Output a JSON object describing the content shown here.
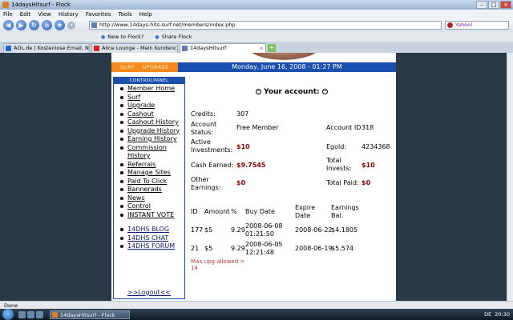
{
  "window": {
    "title": "14daysHitsurf - Flock"
  },
  "menu": [
    "File",
    "Edit",
    "View",
    "History",
    "Favorites",
    "Tools",
    "Help"
  ],
  "nav": {
    "url": "http://www.14days-hits-surf.net/members/index.php",
    "search_placeholder": "Yahoo!"
  },
  "bookmarks": [
    "New to Flock?",
    "Share Flock"
  ],
  "tabs": [
    {
      "label": "AOL.de | Kostenlose Email, Nachri...",
      "active": false
    },
    {
      "label": "Alice Lounge - Mein Kundencenter",
      "active": false
    },
    {
      "label": "14daysHitsurf",
      "active": true
    }
  ],
  "site": {
    "topnav": {
      "surf": "SURF",
      "upgrade": "UPGRADE",
      "date": "Monday, June 16, 2008 - 01:27 PM"
    },
    "sidebar": {
      "heading": "CONTROLPANEL",
      "items": [
        "Member Home",
        "Surf",
        "Upgrade",
        "Cashout",
        "Cashout History",
        "Upgrade History",
        "Earning History",
        "Commission History",
        "Referrals",
        "Manage Sites",
        "Paid To Click",
        "Bannerads",
        "News",
        "Control",
        "INSTANT VOTE"
      ],
      "links": [
        "14DHS BLOG",
        "14DHS CHAT",
        "14DHS FORUM"
      ],
      "logout": ">>Logout<<"
    },
    "account": {
      "title": "Your account:",
      "credits_label": "Credits:",
      "credits": "307",
      "status_label": "Account Status:",
      "status": "Free Member",
      "id_label": "Account ID",
      "id": "318",
      "active_label": "Active Investments:",
      "active": "$10",
      "egold_label": "Egold:",
      "egold": "4234368",
      "cash_label": "Cash Earned:",
      "cash": "$9.7545",
      "total_invests_label": "Total Invests:",
      "total_invests": "$10",
      "other_label": "Other Earnings:",
      "other": "$0",
      "total_paid_label": "Total Paid:",
      "total_paid": "$0"
    },
    "table": {
      "headers": [
        "ID",
        "Amount",
        "%",
        "Buy Date",
        "Expire Date",
        "Earnings Bal."
      ],
      "rows": [
        [
          "177",
          "$5",
          "9.29",
          "2008-06-08 01:21:50",
          "2008-06-22",
          "$4.1805"
        ],
        [
          "21",
          "$5",
          "9.29",
          "2008-06-05 12:21:48",
          "2008-06-19",
          "$5.574"
        ]
      ],
      "note": "Max upg allowed = 14"
    }
  },
  "status": {
    "text": "Done"
  },
  "taskbar": {
    "task": "14daysHitsurf - Flock",
    "lang": "DE",
    "time": "20:30"
  }
}
